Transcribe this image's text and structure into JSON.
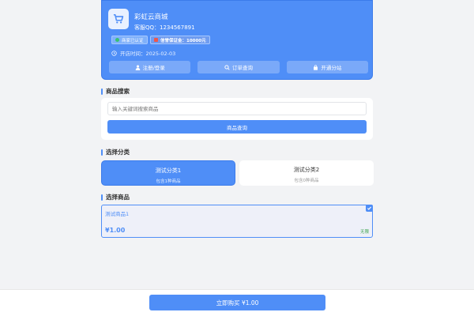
{
  "shop": {
    "name": "彩虹云商城",
    "qq": "客服QQ：1234567891",
    "badges": [
      "商家已认证",
      "信誉保证金：10000元"
    ],
    "open_time": "开店时间：2025-02-03",
    "buttons": [
      "注册/登录",
      "订单查询",
      "开通分站"
    ]
  },
  "search": {
    "title": "商品搜索",
    "placeholder": "输入关键词搜索商品",
    "button": "商品查询"
  },
  "categories": {
    "title": "选择分类",
    "items": [
      {
        "name": "测试分类1",
        "sub": "包含1种商品"
      },
      {
        "name": "测试分类2",
        "sub": "包含0种商品"
      }
    ]
  },
  "products": {
    "title": "选择商品",
    "items": [
      {
        "name": "测试商品1",
        "price": "¥1.00",
        "stock": "无限"
      }
    ]
  },
  "purchase": {
    "button": "立即购买 ¥1.00"
  },
  "colors": {
    "accent": "#4f8ef7",
    "stock": "#3aa34a"
  }
}
